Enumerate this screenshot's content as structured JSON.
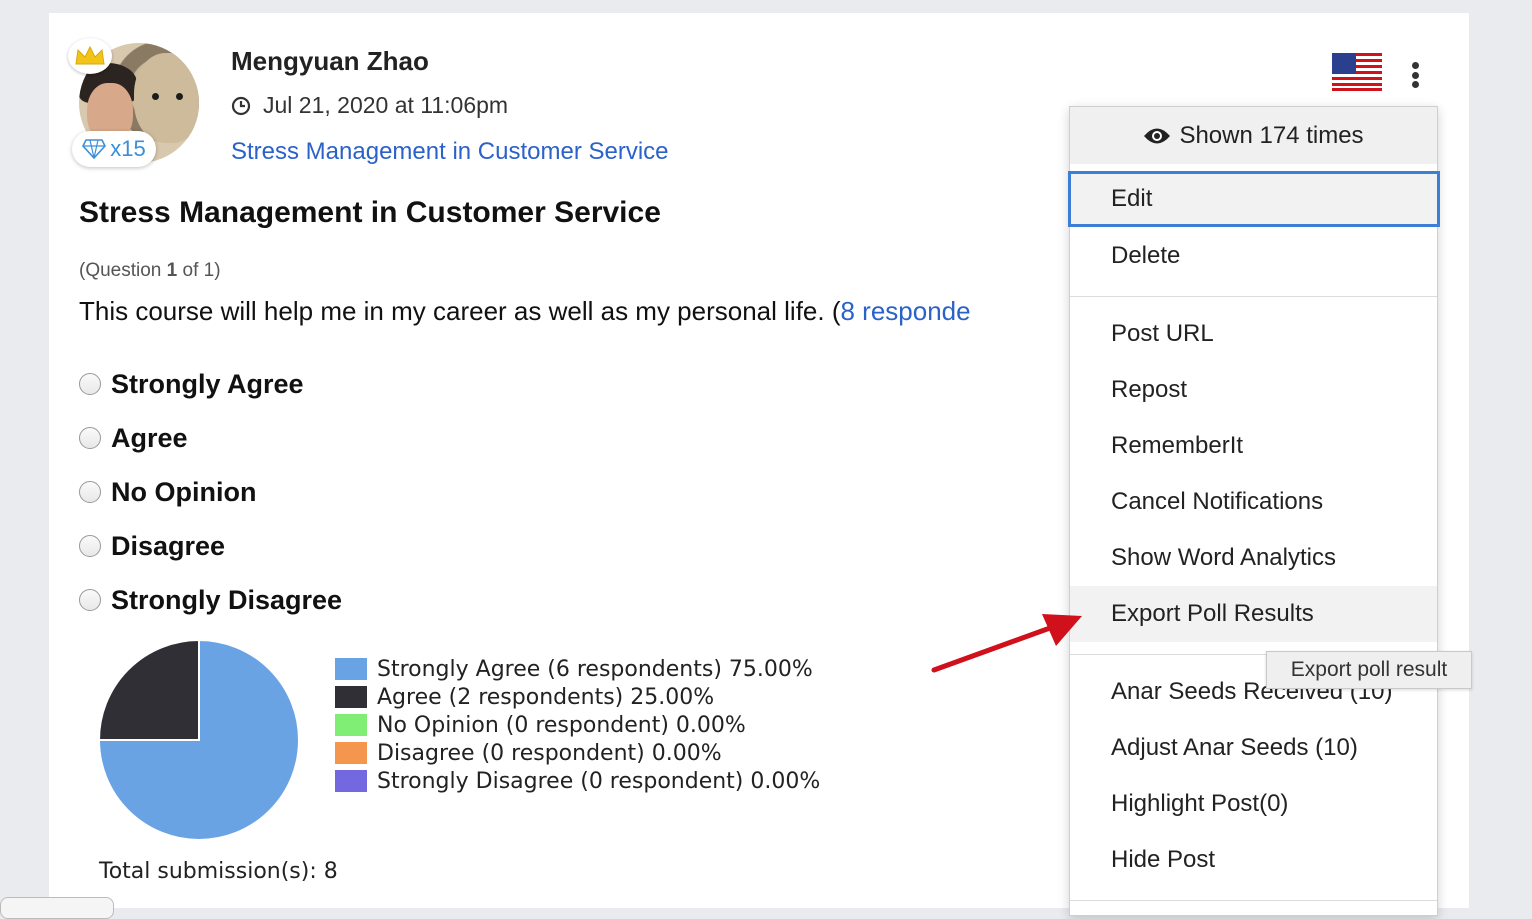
{
  "post": {
    "author": "Mengyuan Zhao",
    "timestamp": "Jul 21, 2020 at 11:06pm",
    "badge_count": "x15",
    "topic_link": "Stress Management in Customer Service",
    "title": "Stress Management in Customer Service"
  },
  "question": {
    "prefix": "(Question ",
    "current": "1",
    "suffix": " of 1)",
    "text": "This course will help me in my career as well as my personal life. (",
    "respondents_link": "8 responde"
  },
  "options": [
    {
      "label": "Strongly Agree"
    },
    {
      "label": "Agree"
    },
    {
      "label": "No Opinion"
    },
    {
      "label": "Disagree"
    },
    {
      "label": "Strongly Disagree"
    }
  ],
  "chart_data": {
    "type": "pie",
    "slices": [
      {
        "label": "Strongly Agree (6 respondents) 75.00%",
        "value": 75.0,
        "color": "#6aa3e4"
      },
      {
        "label": "Agree (2 respondents) 25.00%",
        "value": 25.0,
        "color": "#2f2f35"
      },
      {
        "label": "No Opinion (0 respondent) 0.00%",
        "value": 0.0,
        "color": "#80ee74"
      },
      {
        "label": "Disagree (0 respondent) 0.00%",
        "value": 0.0,
        "color": "#f5964e"
      },
      {
        "label": "Strongly Disagree (0 respondent) 0.00%",
        "value": 0.0,
        "color": "#7468e1"
      }
    ],
    "legend_position": "right"
  },
  "total_submissions": "Total submission(s): 8",
  "menu": {
    "shown": "Shown 174 times",
    "items": [
      "Edit",
      "Delete",
      "Post URL",
      "Repost",
      "RememberIt",
      "Cancel Notifications",
      "Show Word Analytics",
      "Export Poll Results",
      "Anar Seeds Received (10)",
      "Adjust Anar Seeds (10)",
      "Highlight Post(0)",
      "Hide Post"
    ]
  },
  "tooltip": "Export poll result",
  "colors": {
    "link": "#2a62c9",
    "focus_ring": "#3d7fd6",
    "arrow": "#d0101a"
  }
}
